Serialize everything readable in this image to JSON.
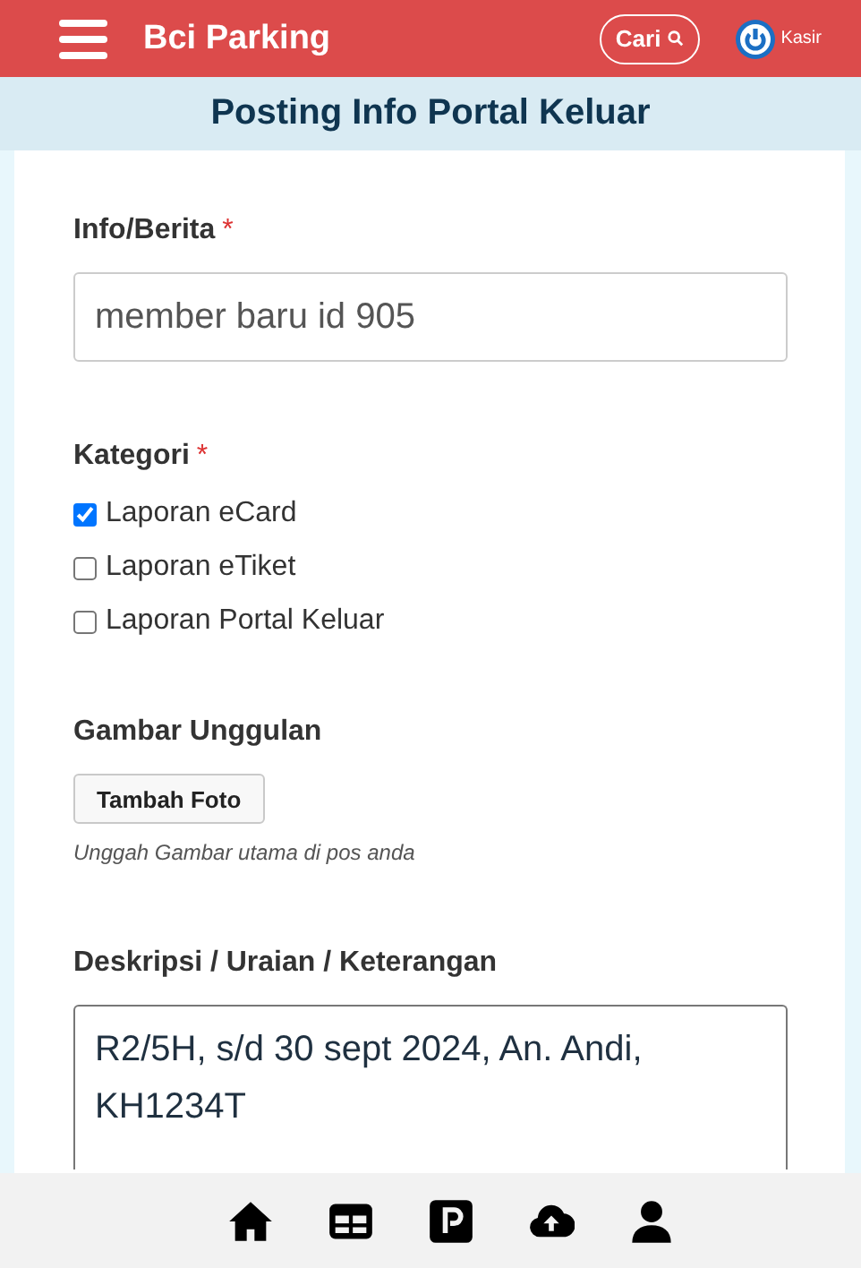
{
  "header": {
    "app_name": "Bci Parking",
    "search_button": "Cari",
    "user_label": "Kasir"
  },
  "page_title": "Posting Info Portal Keluar",
  "form": {
    "info": {
      "label": "Info/Berita",
      "required_mark": "*",
      "value": "member baru id 905"
    },
    "category": {
      "label": "Kategori",
      "required_mark": "*",
      "options": [
        {
          "label": "Laporan eCard",
          "checked": true
        },
        {
          "label": "Laporan eTiket",
          "checked": false
        },
        {
          "label": "Laporan Portal Keluar",
          "checked": false
        }
      ]
    },
    "image": {
      "label": "Gambar Unggulan",
      "button": "Tambah Foto",
      "help": "Unggah Gambar utama di pos anda"
    },
    "description": {
      "label": "Deskripsi / Uraian / Keterangan",
      "value": "R2/5H, s/d 30 sept 2024, An. Andi, KH1234T"
    }
  },
  "bottom_nav": [
    {
      "kind": "home"
    },
    {
      "kind": "grid"
    },
    {
      "kind": "parking"
    },
    {
      "kind": "upload"
    },
    {
      "kind": "user"
    }
  ]
}
